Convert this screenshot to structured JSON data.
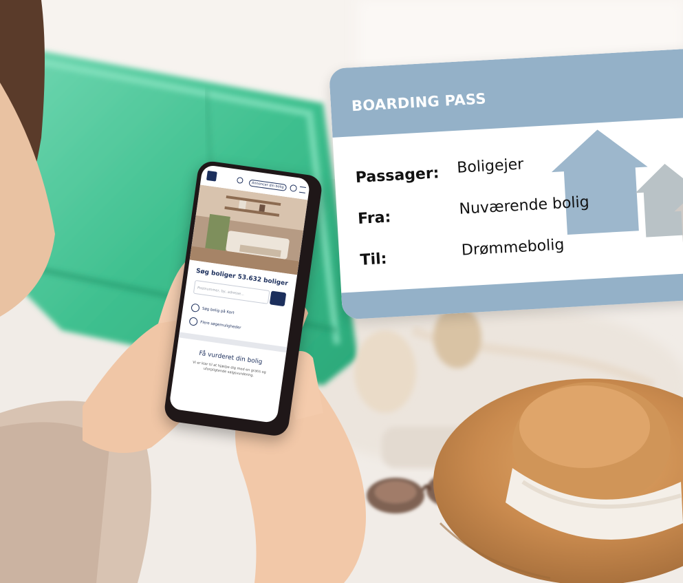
{
  "boarding_pass": {
    "title": "BOARDING PASS",
    "fields": [
      {
        "label": "Passager:",
        "value": "Boligejer"
      },
      {
        "label": "Fra:",
        "value": "Nuværende bolig"
      },
      {
        "label": "Til:",
        "value": "Drømmebolig"
      }
    ],
    "header_color": "#94b1c8"
  },
  "phone": {
    "cta_button": "Annoncer din bolig",
    "search_heading": "Søg boliger 53.632 boliger",
    "search_placeholder": "Postnummer, by, adresse...",
    "links": [
      "Søg bolig på Kort",
      "Flere søgemuligheder"
    ],
    "valuation_heading": "Få vurderet din bolig",
    "valuation_text": "Vi er klar til at hjælpe dig med en gratis og uforpligtende salgsvurdering.",
    "brand_color": "#1c2f5c"
  }
}
